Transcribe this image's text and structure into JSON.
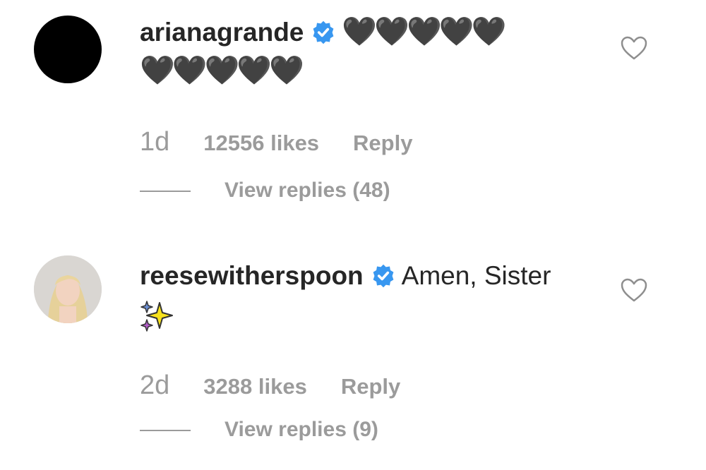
{
  "comments": [
    {
      "username": "arianagrande",
      "verified": true,
      "text_line1": "🖤🖤🖤🖤🖤",
      "text_line2": "🖤🖤🖤🖤🖤",
      "age": "1d",
      "likes": "12556 likes",
      "reply": "Reply",
      "view_replies": "View replies (48)"
    },
    {
      "username": "reesewitherspoon",
      "verified": true,
      "text_line1": "Amen, Sister",
      "text_line2_icon": "sparkles-icon",
      "age": "2d",
      "likes": "3288 likes",
      "reply": "Reply",
      "view_replies": "View replies (9)"
    }
  ],
  "colors": {
    "verified_blue": "#3897f0",
    "meta_gray": "#9b9b9b",
    "username": "#262626"
  }
}
